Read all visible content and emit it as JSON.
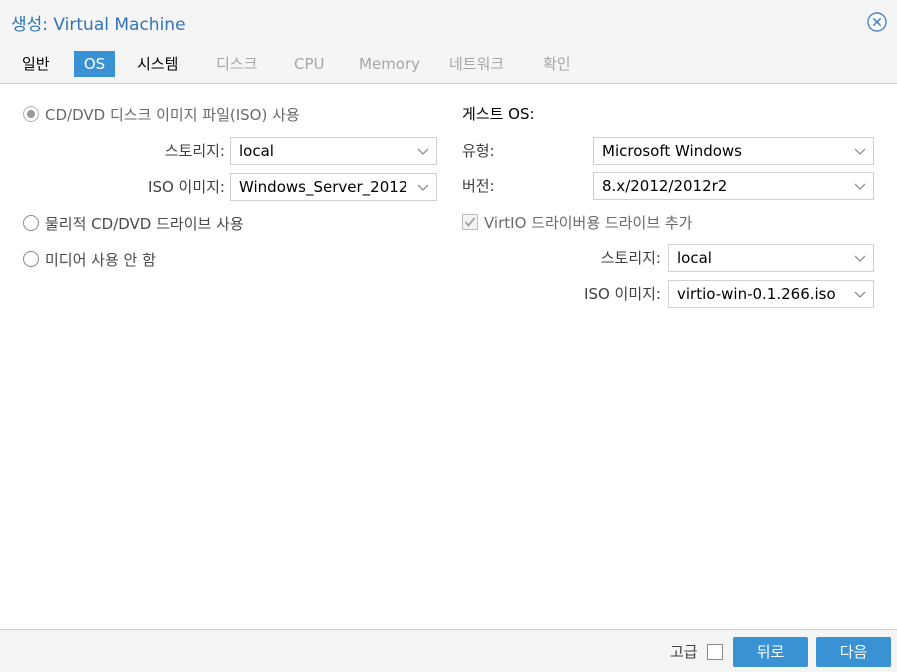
{
  "window": {
    "title": "생성: Virtual Machine",
    "close_icon": "close-circle-icon"
  },
  "tabs": [
    {
      "label": "일반",
      "state": "enabled"
    },
    {
      "label": "OS",
      "state": "active"
    },
    {
      "label": "시스템",
      "state": "enabled"
    },
    {
      "label": "디스크",
      "state": "disabled"
    },
    {
      "label": "CPU",
      "state": "disabled"
    },
    {
      "label": "Memory",
      "state": "disabled"
    },
    {
      "label": "네트워크",
      "state": "disabled"
    },
    {
      "label": "확인",
      "state": "disabled"
    }
  ],
  "media": {
    "option_iso": "CD/DVD 디스크 이미지 파일(ISO) 사용",
    "option_iso_selected": true,
    "storage_label": "스토리지:",
    "storage_value": "local",
    "iso_label": "ISO 이미지:",
    "iso_value": "Windows_Server_2012",
    "option_physical": "물리적 CD/DVD 드라이브 사용",
    "option_none": "미디어 사용 안 함"
  },
  "guest_os": {
    "section_title": "게스트 OS:",
    "type_label": "유형:",
    "type_value": "Microsoft Windows",
    "version_label": "버전:",
    "version_value": "8.x/2012/2012r2",
    "virtio_checkbox_label": "VirtIO 드라이버용 드라이브 추가",
    "virtio_checked": true,
    "virtio_storage_label": "스토리지:",
    "virtio_storage_value": "local",
    "virtio_iso_label": "ISO 이미지:",
    "virtio_iso_value": "virtio-win-0.1.266.iso"
  },
  "footer": {
    "advanced_label": "고급",
    "advanced_checked": false,
    "back_label": "뒤로",
    "next_label": "다음"
  },
  "colors": {
    "accent": "#3892d4",
    "title": "#3174b8"
  }
}
